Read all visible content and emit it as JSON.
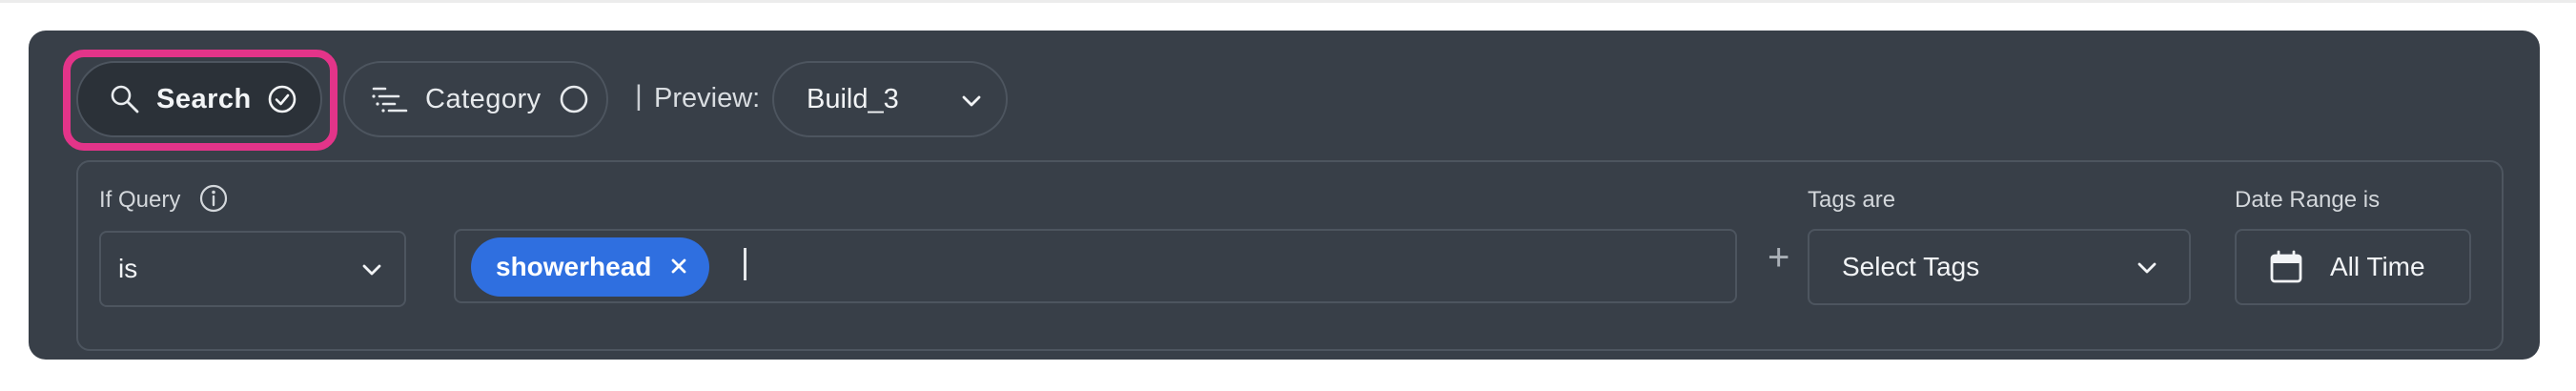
{
  "toolbar": {
    "search_label": "Search",
    "category_label": "Category",
    "separator": "|",
    "preview_label": "Preview:",
    "preview_value": "Build_3"
  },
  "filters": {
    "query_label": "If Query",
    "operator_value": "is",
    "query_chips": [
      "showerhead"
    ],
    "plus_label": "+",
    "tags_label": "Tags are",
    "tags_placeholder": "Select Tags",
    "date_label": "Date Range is",
    "date_value": "All Time"
  },
  "colors": {
    "panel": "#383f48",
    "highlight": "#e33489",
    "chip": "#2f6fe0"
  },
  "icons": {
    "search": "search-icon",
    "search_check": "check-circle-icon",
    "category": "filter-lines-icon",
    "category_status": "empty-circle-icon",
    "preview_chevron": "chevron-down-icon",
    "info": "info-icon",
    "chip_remove": "close-icon",
    "calendar": "calendar-icon"
  }
}
